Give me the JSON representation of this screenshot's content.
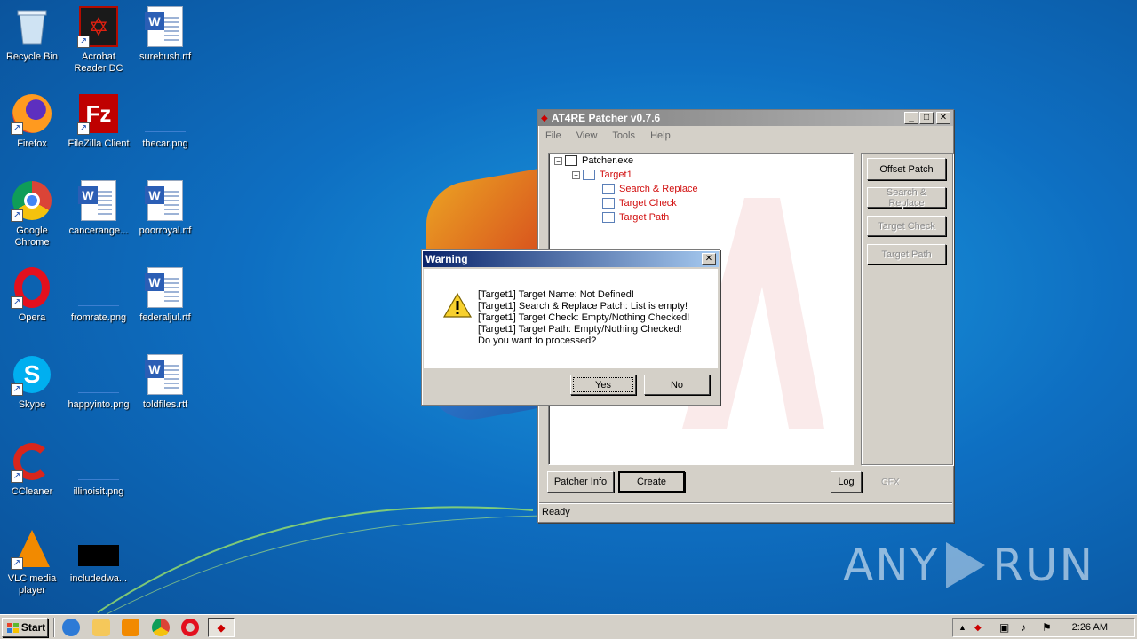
{
  "desktop": {
    "icons": [
      {
        "label": "Recycle Bin"
      },
      {
        "label": "Acrobat Reader DC"
      },
      {
        "label": "surebush.rtf"
      },
      {
        "label": "Firefox"
      },
      {
        "label": "FileZilla Client"
      },
      {
        "label": "thecar.png"
      },
      {
        "label": "Google Chrome"
      },
      {
        "label": "cancerange..."
      },
      {
        "label": "poorroyal.rtf"
      },
      {
        "label": "Opera"
      },
      {
        "label": "fromrate.png"
      },
      {
        "label": "federaljul.rtf"
      },
      {
        "label": "Skype"
      },
      {
        "label": "happyinto.png"
      },
      {
        "label": "toldfiles.rtf"
      },
      {
        "label": "CCleaner"
      },
      {
        "label": "illinoisit.png"
      },
      {
        "label": "VLC media player"
      },
      {
        "label": "includedwa..."
      }
    ],
    "watermark": {
      "left": "ANY",
      "right": "RUN"
    }
  },
  "patcher": {
    "title": "AT4RE Patcher v0.7.6",
    "menu": [
      "File",
      "View",
      "Tools",
      "Help"
    ],
    "tree": {
      "root": "Patcher.exe",
      "target": "Target1",
      "children": [
        "Search & Replace",
        "Target Check",
        "Target Path"
      ]
    },
    "side_buttons": {
      "offset_patch": "Offset Patch",
      "search_replace": "Search & Replace",
      "target_check": "Target Check",
      "target_path": "Target Path"
    },
    "bottom_buttons": {
      "patcher_info": "Patcher Info",
      "create": "Create",
      "log": "Log",
      "gfx": "GFX"
    },
    "status": "Ready"
  },
  "dialog": {
    "title": "Warning",
    "lines": [
      "[Target1] Target Name: Not Defined!",
      "[Target1] Search & Replace Patch: List is empty!",
      "[Target1] Target Check: Empty/Nothing Checked!",
      "[Target1] Target Path: Empty/Nothing Checked!",
      "Do you want to processed?"
    ],
    "yes": "Yes",
    "no": "No"
  },
  "taskbar": {
    "start": "Start",
    "clock": "2:26 AM"
  },
  "colors": {
    "desktop": "#0e6fc2",
    "active_title": "#0a246a",
    "tree_red": "#d21010"
  }
}
